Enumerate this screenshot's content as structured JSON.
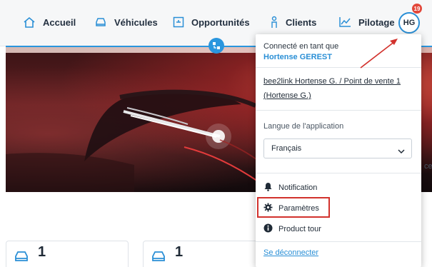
{
  "nav": {
    "items": [
      {
        "label": "Accueil",
        "icon": "home-icon"
      },
      {
        "label": "Véhicules",
        "icon": "car-icon"
      },
      {
        "label": "Opportunités",
        "icon": "opportunity-icon"
      },
      {
        "label": "Clients",
        "icon": "client-icon"
      },
      {
        "label": "Pilotage",
        "icon": "chart-icon"
      }
    ],
    "avatar_initials": "HG",
    "notification_count": "19"
  },
  "menu": {
    "connected_label": "Connecté en tant que",
    "user_name": "Hortense GEREST",
    "account_link": "bee2link Hortense G. / Point de vente 1 (Hortense G.)",
    "language_label": "Langue de l'application",
    "language_value": "Français",
    "notification_label": "Notification",
    "settings_label": "Paramètres",
    "tour_label": "Product tour",
    "logout_label": "Se déconnecter"
  },
  "cards": [
    {
      "count": "1"
    },
    {
      "count": "1"
    }
  ],
  "side_text": "ce",
  "colors": {
    "accent": "#2a8fd6",
    "highlight_box": "#d2322d",
    "badge": "#e2473a"
  }
}
